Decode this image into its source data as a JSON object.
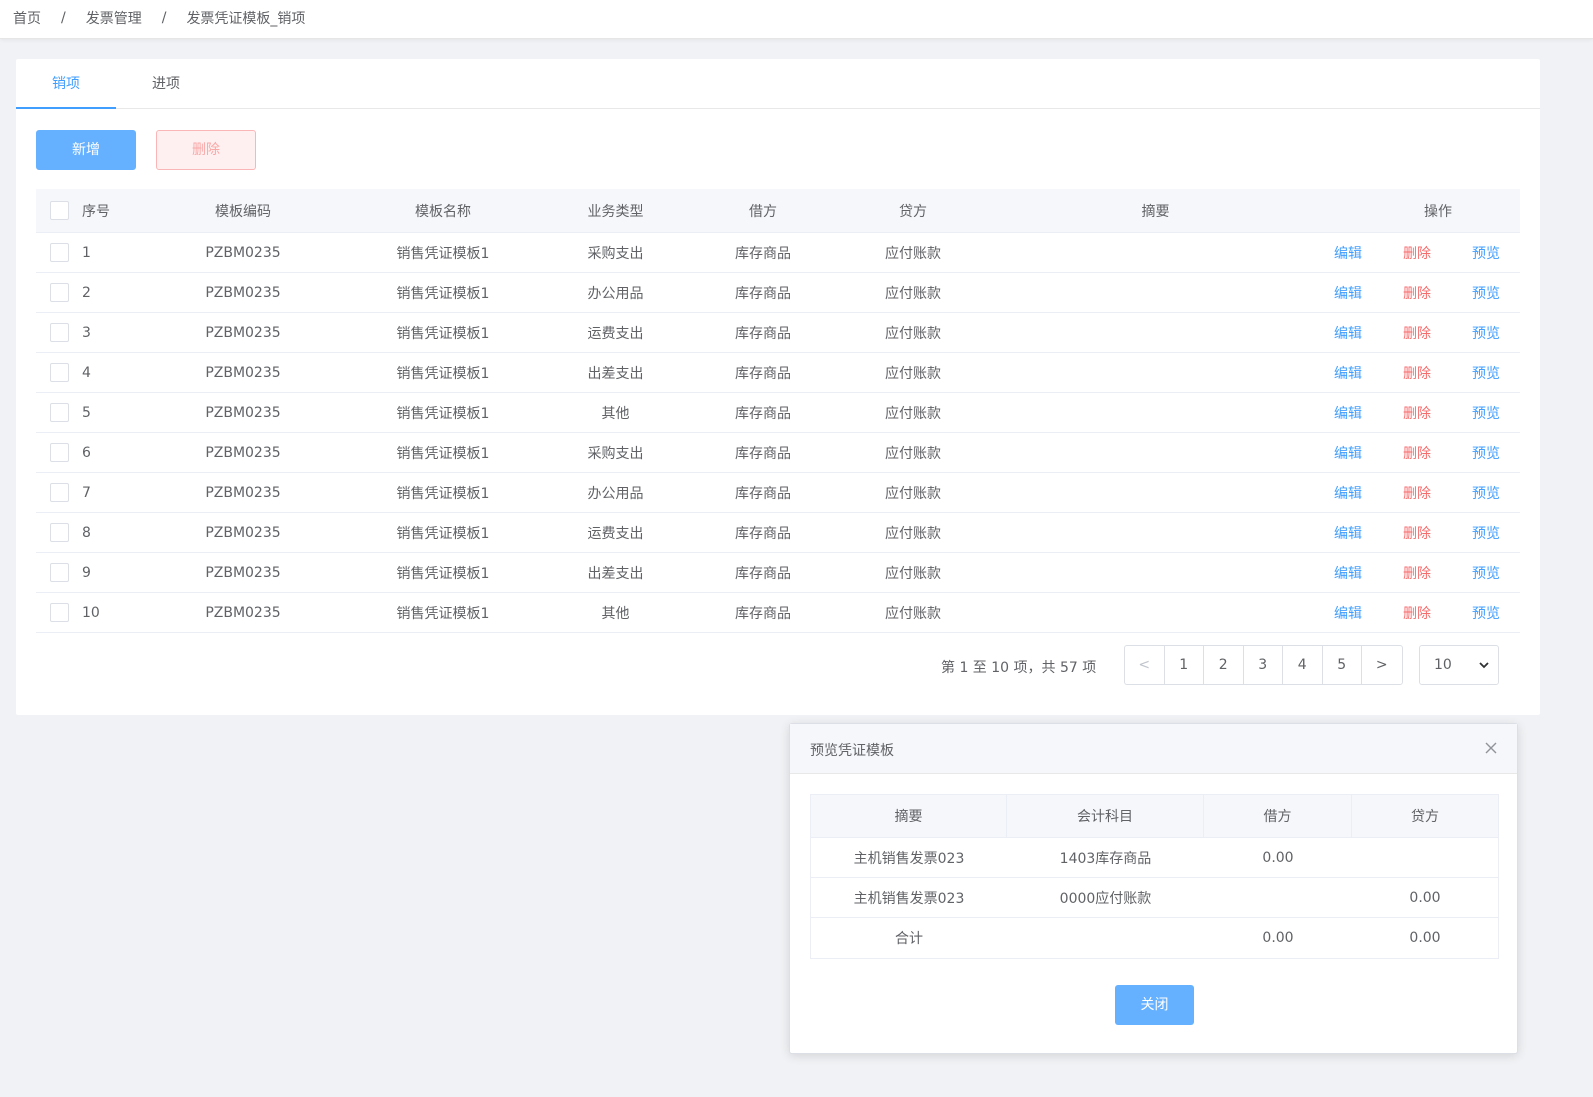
{
  "breadcrumb": {
    "home": "首页",
    "sep": "/",
    "section": "发票管理",
    "current": "发票凭证模板_销项"
  },
  "tabs": [
    {
      "label": "销项"
    },
    {
      "label": "进项"
    }
  ],
  "toolbar": {
    "add_label": "新增",
    "delete_label": "删除"
  },
  "table": {
    "headers": {
      "index": "序号",
      "code": "模板编码",
      "name": "模板名称",
      "type": "业务类型",
      "debit": "借方",
      "credit": "贷方",
      "summary": "摘要",
      "ops": "操作"
    },
    "ops": {
      "edit": "编辑",
      "delete": "删除",
      "preview": "预览"
    },
    "rows": [
      {
        "index": "1",
        "code": "PZBM0235",
        "name": "销售凭证模板1",
        "type": "采购支出",
        "debit": "库存商品",
        "credit": "应付账款"
      },
      {
        "index": "2",
        "code": "PZBM0235",
        "name": "销售凭证模板1",
        "type": "办公用品",
        "debit": "库存商品",
        "credit": "应付账款"
      },
      {
        "index": "3",
        "code": "PZBM0235",
        "name": "销售凭证模板1",
        "type": "运费支出",
        "debit": "库存商品",
        "credit": "应付账款"
      },
      {
        "index": "4",
        "code": "PZBM0235",
        "name": "销售凭证模板1",
        "type": "出差支出",
        "debit": "库存商品",
        "credit": "应付账款"
      },
      {
        "index": "5",
        "code": "PZBM0235",
        "name": "销售凭证模板1",
        "type": "其他",
        "debit": "库存商品",
        "credit": "应付账款"
      },
      {
        "index": "6",
        "code": "PZBM0235",
        "name": "销售凭证模板1",
        "type": "采购支出",
        "debit": "库存商品",
        "credit": "应付账款"
      },
      {
        "index": "7",
        "code": "PZBM0235",
        "name": "销售凭证模板1",
        "type": "办公用品",
        "debit": "库存商品",
        "credit": "应付账款"
      },
      {
        "index": "8",
        "code": "PZBM0235",
        "name": "销售凭证模板1",
        "type": "运费支出",
        "debit": "库存商品",
        "credit": "应付账款"
      },
      {
        "index": "9",
        "code": "PZBM0235",
        "name": "销售凭证模板1",
        "type": "出差支出",
        "debit": "库存商品",
        "credit": "应付账款"
      },
      {
        "index": "10",
        "code": "PZBM0235",
        "name": "销售凭证模板1",
        "type": "其他",
        "debit": "库存商品",
        "credit": "应付账款"
      }
    ]
  },
  "pagination": {
    "info": "第 1 至 10 项，共 57 项",
    "prev": "<",
    "pages": [
      "1",
      "2",
      "3",
      "4",
      "5"
    ],
    "next": ">",
    "page_size": "10"
  },
  "dialog": {
    "title": "预览凭证模板",
    "headers": {
      "summary": "摘要",
      "account": "会计科目",
      "debit": "借方",
      "credit": "贷方"
    },
    "rows": [
      {
        "summary": "主机销售发票023",
        "account": "1403库存商品",
        "debit": "0.00",
        "credit": ""
      },
      {
        "summary": "主机销售发票023",
        "account": "0000应付账款",
        "debit": "",
        "credit": "0.00"
      },
      {
        "summary": "合计",
        "account": "",
        "debit": "0.00",
        "credit": "0.00"
      }
    ],
    "close_label": "关闭"
  },
  "colors": {
    "primary": "#409eff",
    "danger": "#f56c6c"
  },
  "icons": {
    "close": "close-icon",
    "select_arrow": "chevron-down-icon"
  }
}
